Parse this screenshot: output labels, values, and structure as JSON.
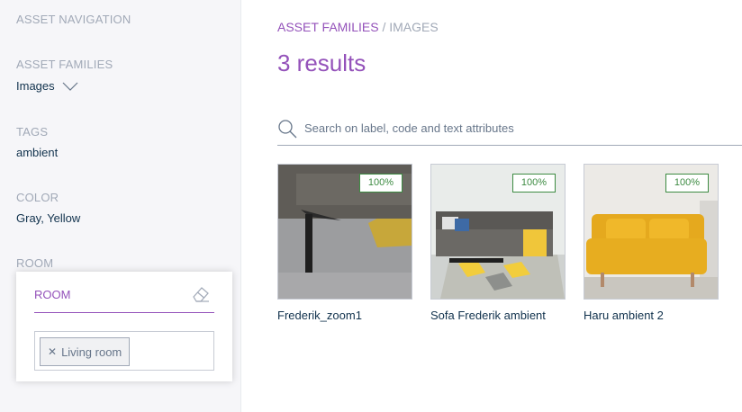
{
  "sidebar": {
    "nav_title": "ASSET NAVIGATION",
    "families_heading": "ASSET FAMILIES",
    "family_value": "Images",
    "tags_heading": "TAGS",
    "tags_value": "ambient",
    "color_heading": "COLOR",
    "color_value": "Gray, Yellow",
    "room_heading": "ROOM"
  },
  "room_panel": {
    "title": "ROOM",
    "eraser_icon": "eraser-icon",
    "chips": [
      {
        "label": "Living room",
        "remove_icon": "close-icon"
      }
    ]
  },
  "header": {
    "breadcrumb_link": "ASSET FAMILIES",
    "breadcrumb_separator": "/",
    "breadcrumb_current": "IMAGES",
    "results": "3 results"
  },
  "search": {
    "placeholder": "Search on label, code and text attributes",
    "icon": "search-icon"
  },
  "assets": [
    {
      "label": "Frederik_zoom1",
      "completeness": "100%"
    },
    {
      "label": "Sofa Frederik ambient",
      "completeness": "100%"
    },
    {
      "label": "Haru ambient 2",
      "completeness": "100%"
    }
  ],
  "colors": {
    "accent": "#9452ba",
    "success": "#3d8b42",
    "text": "#11324d",
    "muted": "#a1a9b7",
    "sidebar_bg": "#f6f6f9"
  }
}
